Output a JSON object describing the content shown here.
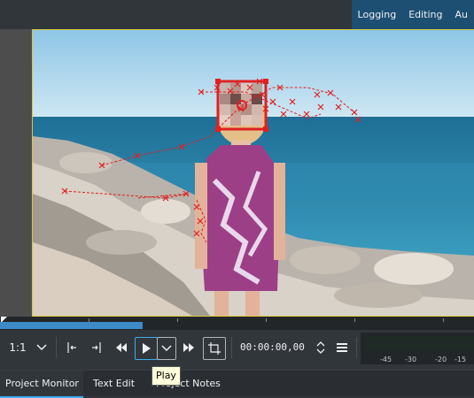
{
  "workspace_tabs": [
    {
      "label": "Logging"
    },
    {
      "label": "Editing"
    },
    {
      "label": "Au"
    }
  ],
  "monitor": {
    "zoom_label": "1:1",
    "timecode": "00:00:00,00",
    "tooltip": "Play",
    "progress_fraction": 0.3
  },
  "icons": {
    "zoom_dropdown": "chevron-down-icon",
    "set_zone_in": "zone-in-icon",
    "set_zone_out": "zone-out-icon",
    "rewind": "rewind-icon",
    "play": "play-icon",
    "play_options": "chevron-down-icon",
    "forward": "fast-forward-icon",
    "crop": "crop-icon",
    "timecode_stepper": "up-down-arrows-icon",
    "menu": "hamburger-menu-icon"
  },
  "audio_meter": {
    "scale_labels": [
      "-45",
      "-30",
      "-20",
      "-15"
    ]
  },
  "bottom_tabs": [
    {
      "label": "Project Monitor",
      "active": true
    },
    {
      "label": "Text Edit",
      "active": false
    },
    {
      "label": "Project Notes",
      "active": false
    }
  ],
  "colors": {
    "accent": "#3daee9",
    "tracking_marker": "#e02020",
    "frame_border": "#d7c740"
  }
}
